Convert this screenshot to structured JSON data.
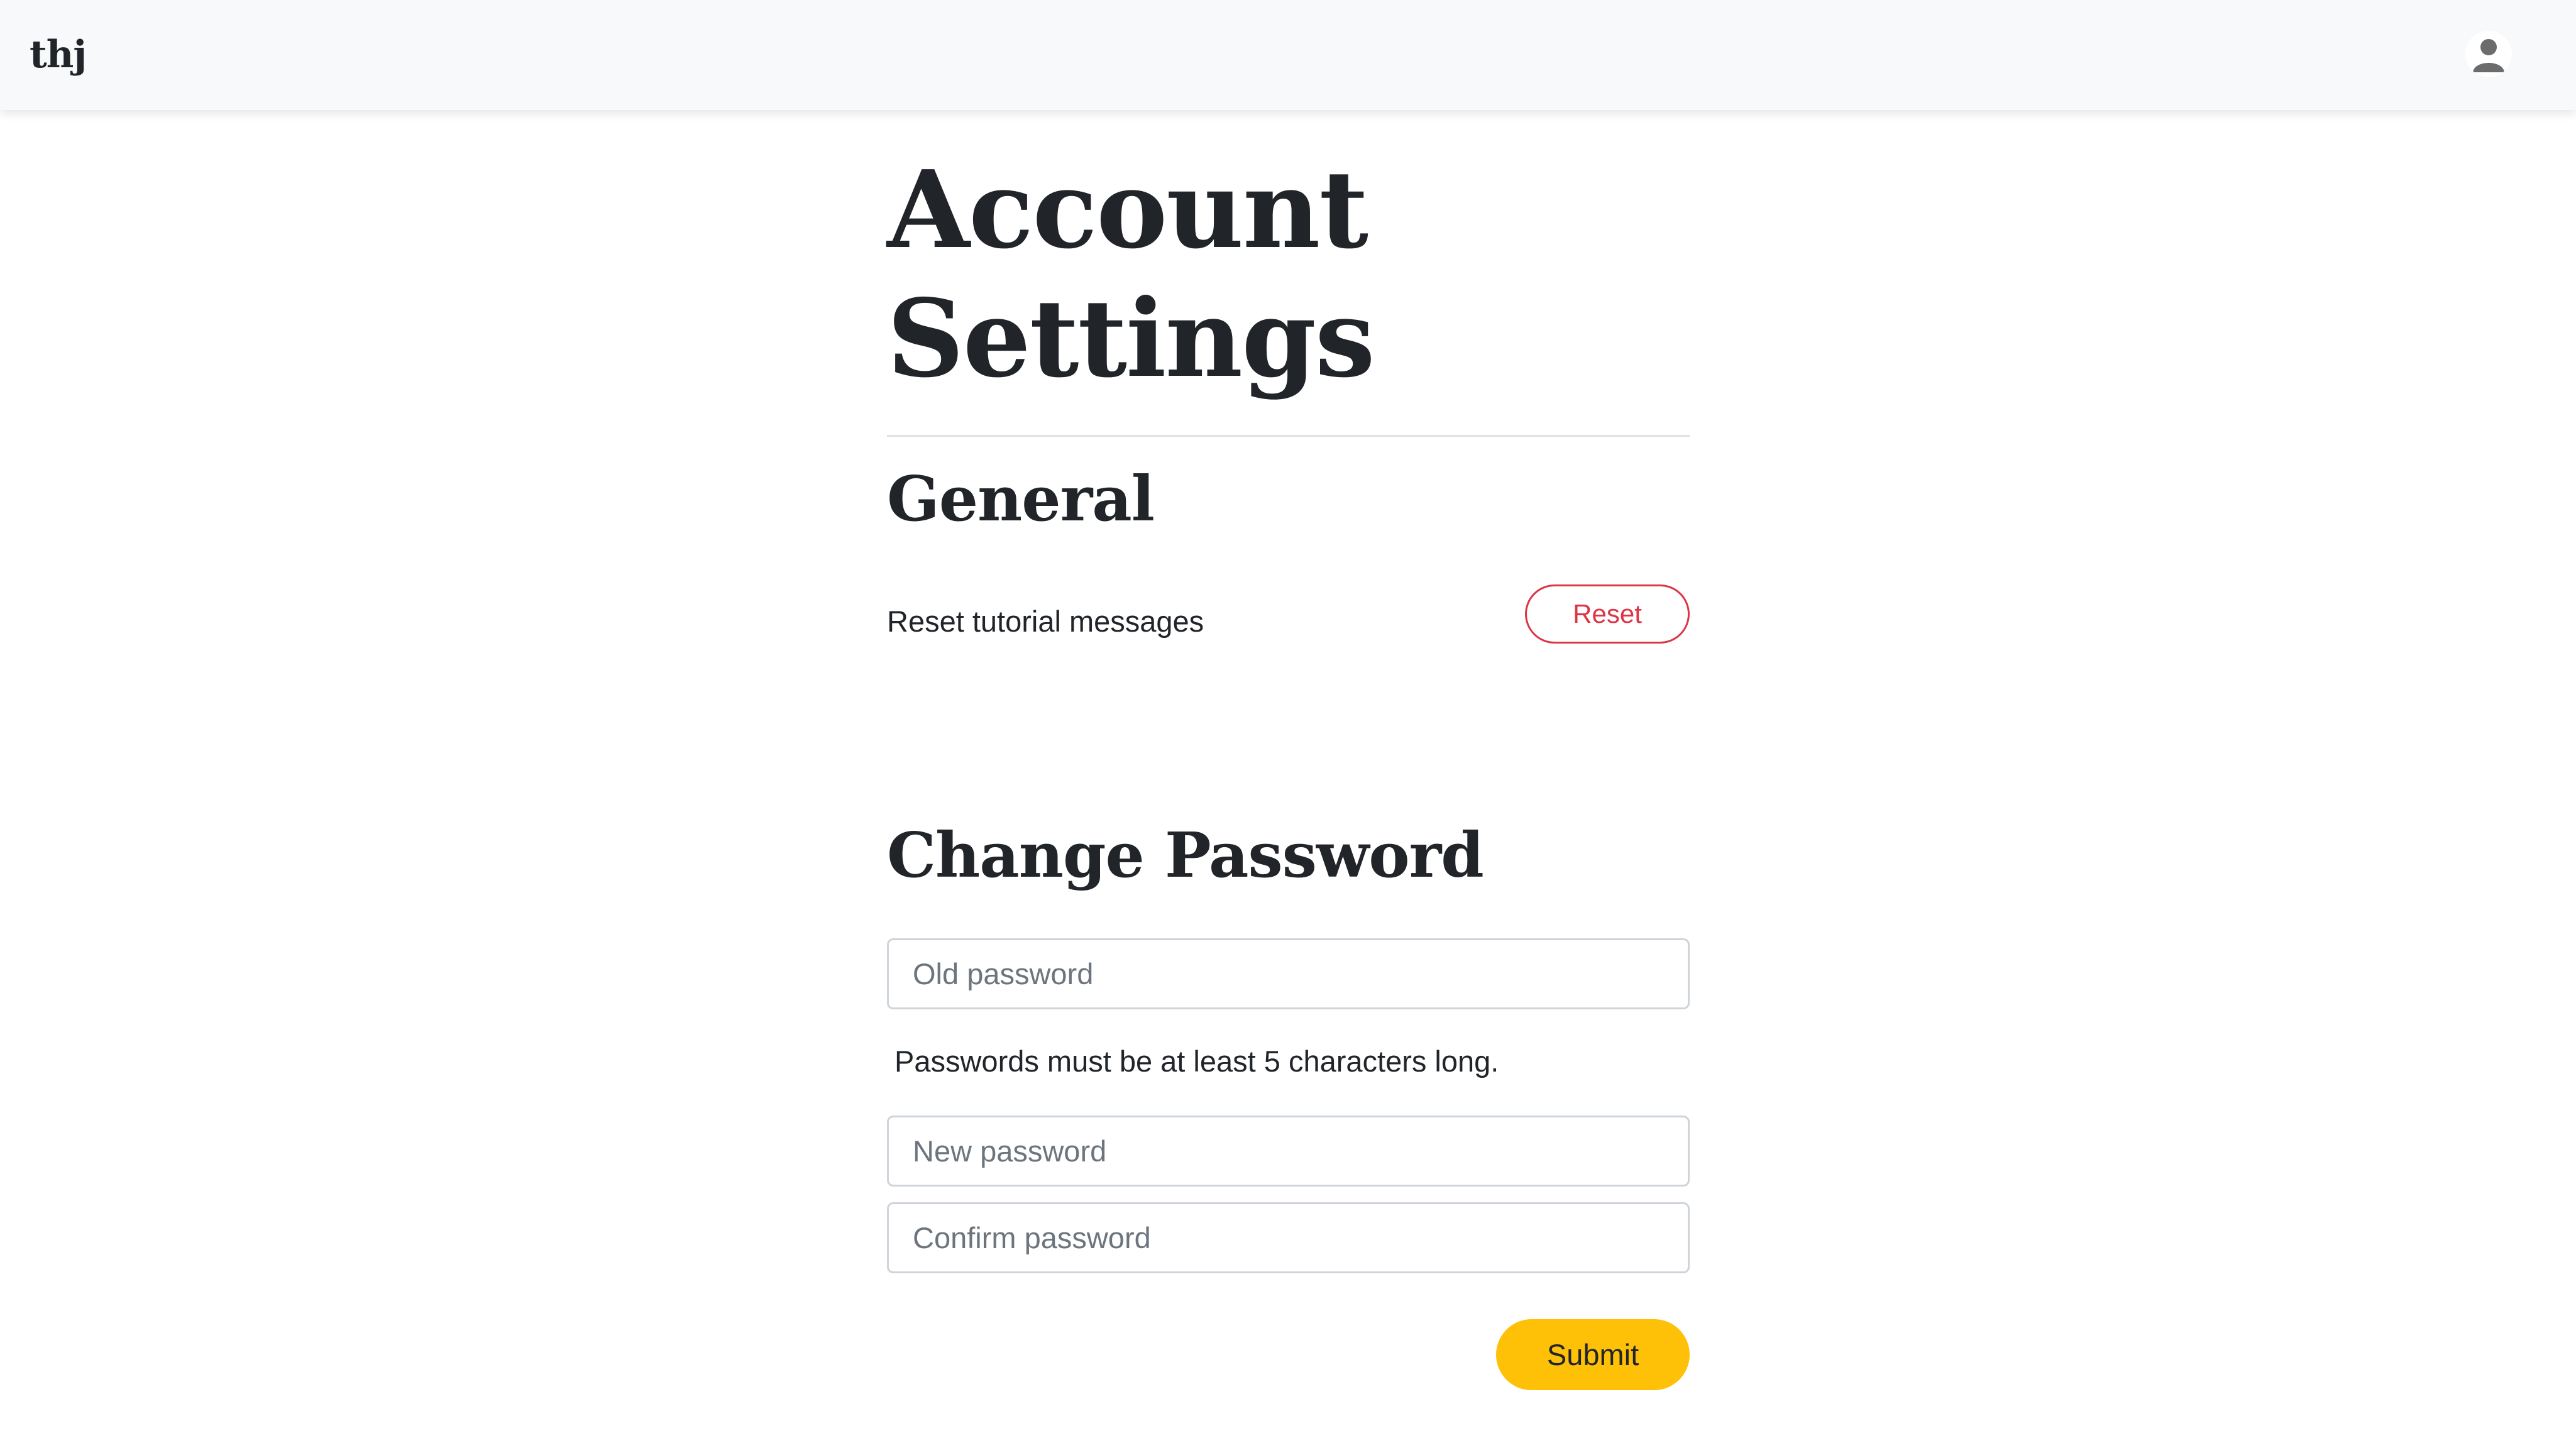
{
  "navbar": {
    "brand": "thj",
    "avatar_icon": "user-avatar-icon"
  },
  "page": {
    "title": "Account Settings"
  },
  "general": {
    "heading": "General",
    "reset_tutorial_label": "Reset tutorial messages",
    "reset_button_label": "Reset"
  },
  "change_password": {
    "heading": "Change Password",
    "old_password_placeholder": "Old password",
    "old_password_value": "",
    "hint": "Passwords must be at least 5 characters long.",
    "new_password_placeholder": "New password",
    "new_password_value": "",
    "confirm_password_placeholder": "Confirm password",
    "confirm_password_value": "",
    "submit_label": "Submit"
  },
  "colors": {
    "navbar_bg": "#f8f9fa",
    "danger": "#dc3545",
    "warning": "#ffc107",
    "text": "#212529",
    "placeholder": "#6c757d"
  }
}
